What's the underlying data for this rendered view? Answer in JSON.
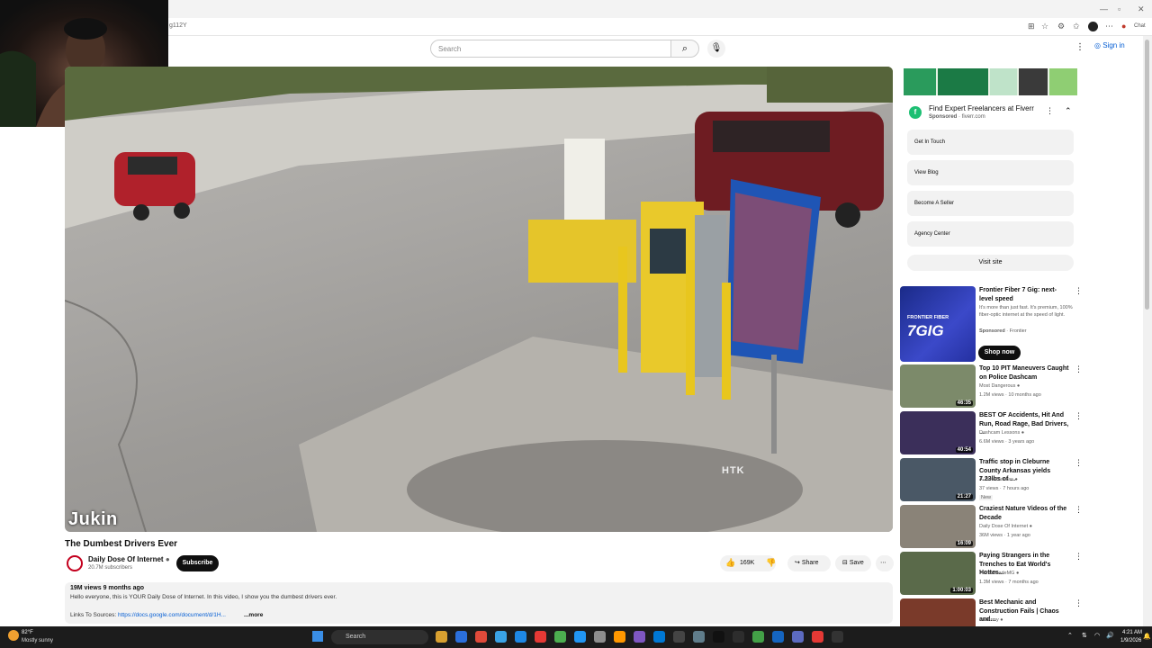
{
  "browser": {
    "url": "g112Y",
    "chat_label": "Chat"
  },
  "header": {
    "search_placeholder": "Search",
    "sign_in": "Sign in"
  },
  "video": {
    "watermark": "Jukin",
    "corner_text": "HTK",
    "title": "The Dumbest Drivers Ever"
  },
  "channel": {
    "name": "Daily Dose Of Internet",
    "subscribers": "20.7M subscribers",
    "subscribe_label": "Subscribe"
  },
  "actions": {
    "likes": "169K",
    "share": "Share",
    "save": "Save"
  },
  "description": {
    "stats": "19M views  9 months ago",
    "text": "Hello everyone, this is YOUR Daily Dose of Internet. In this video, I show you the dumbest drivers ever.",
    "links_label": "Links To Sources:",
    "link": "https://docs.google.com/document/d/1H...",
    "more": "...more"
  },
  "ad": {
    "title": "Find Expert Freelancers at Fiverr",
    "sponsored": "Sponsored",
    "domain": "fiverr.com",
    "buttons": [
      "Get In Touch",
      "View Blog",
      "Become A Seller",
      "Agency Center"
    ],
    "visit_site": "Visit site"
  },
  "promo": {
    "title": "Frontier Fiber 7 Gig: next-level speed",
    "description": "It's more than just fast. It's premium, 100% fiber-optic internet at the speed of light.",
    "sponsored": "Sponsored",
    "advertiser": "Frontier",
    "thumb_brand": "FRONTIER FIBER",
    "thumb_big": "7GIG",
    "cta": "Shop now"
  },
  "recommendations": [
    {
      "title": "Top 10 PIT Maneuvers Caught on Police Dashcam",
      "channel": "Most Dangerous",
      "meta": "1.2M views · 10 months ago",
      "duration": "46:35",
      "color": "#7c8a6a"
    },
    {
      "title": "BEST OF Accidents, Hit And Run, Road Rage, Bad Drivers, ...",
      "channel": "Dashcam Lessons",
      "meta": "6.6M views · 3 years ago",
      "duration": "40:54",
      "color": "#3b2f5a"
    },
    {
      "title": "Traffic stop in Cleburne County Arkansas yields 7.23lbs of ...",
      "channel": "A-ZoneOutlaws",
      "meta": "37 views · 7 hours ago",
      "badge": "New",
      "duration": "21:27",
      "color": "#4a5866"
    },
    {
      "title": "Craziest Nature Videos of the Decade",
      "channel": "Daily Dose Of Internet",
      "meta": "36M views · 1 year ago",
      "duration": "16:09",
      "color": "#8a8378"
    },
    {
      "title": "Paying Strangers in the Trenches to Eat World's Hottes...",
      "channel": "FloridaMadeMG",
      "meta": "1.3M views · 7 months ago",
      "duration": "1:00:03",
      "color": "#5a6a4a"
    },
    {
      "title": "Best Mechanic and Construction Fails | Chaos and...",
      "channel": "FailArmy",
      "meta": "",
      "duration": "",
      "color": "#7a3a2a"
    }
  ],
  "taskbar": {
    "temp": "82°F",
    "weather": "Mostly sunny",
    "search": "Search",
    "time": "4:21 AM",
    "date": "1/9/2026"
  }
}
